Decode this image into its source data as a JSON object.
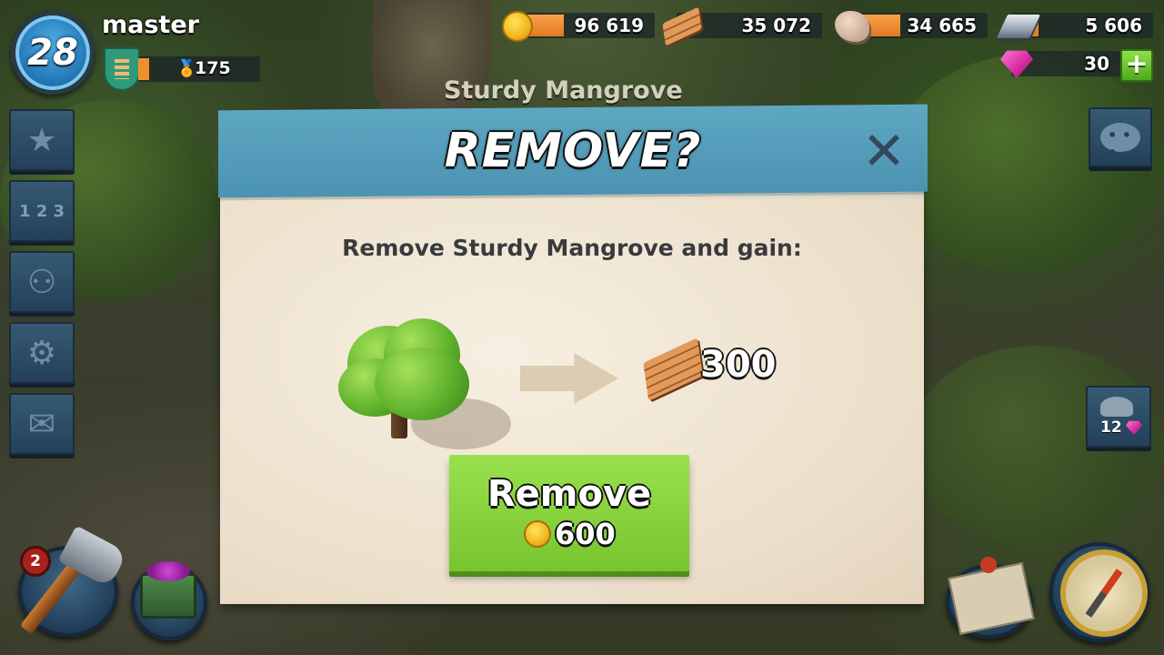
{
  "player": {
    "level": "28",
    "name": "master",
    "victory_points": "175"
  },
  "resources": {
    "gold": "96 619",
    "wood": "35 072",
    "stone": "34 665",
    "iron": "5 606",
    "diamonds": "30"
  },
  "building_label": "Sturdy Mangrove",
  "dialog": {
    "title": "REMOVE?",
    "message": "Remove Sturdy Mangrove and gain:",
    "reward_amount": "300",
    "reward_icon": "wood-icon",
    "button_label": "Remove",
    "button_cost": "600",
    "cost_icon": "gold-coin-icon"
  },
  "side_menu": {
    "ranking_label": "1 2 3"
  },
  "notifications": {
    "builder_count": "2",
    "builder_huts": "12"
  },
  "colors": {
    "header": "#5ea7c2",
    "button": "#8ad440",
    "resource_bar": "#f0912e",
    "panel": "#f3ead9"
  }
}
